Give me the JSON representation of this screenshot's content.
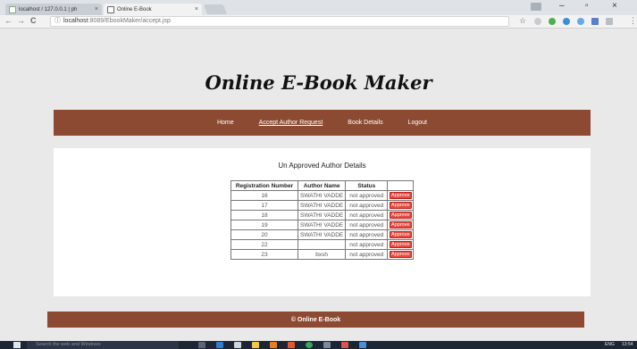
{
  "browser": {
    "tabs": [
      {
        "title": "localhost / 127.0.0.1 | ph",
        "active": false
      },
      {
        "title": "Online E-Book",
        "active": true
      }
    ],
    "window_controls": {
      "minimize": "–",
      "maximize": "▫",
      "close": "×"
    },
    "url_host": "localhost",
    "url_rest": ":8089/EbookMaker/accept.jsp",
    "nav_back": "←",
    "nav_forward": "→",
    "nav_reload": "C",
    "info_icon": "ⓘ",
    "star_icon": "☆",
    "menu_icon": "⋮"
  },
  "site": {
    "title": "Online E-Book Maker",
    "nav": [
      {
        "label": "Home",
        "current": false
      },
      {
        "label": "Accept Author Request",
        "current": true
      },
      {
        "label": "Book Details",
        "current": false
      },
      {
        "label": "Logout",
        "current": false
      }
    ]
  },
  "main": {
    "heading": "Un Approved Author Details",
    "columns": [
      "Registration Number",
      "Author Name",
      "Status",
      ""
    ],
    "approve_label": "Approve",
    "rows": [
      {
        "reg": "16",
        "name": "SWATHI VADDE",
        "status": "not approved"
      },
      {
        "reg": "17",
        "name": "SWATHI VADDE",
        "status": "not approved"
      },
      {
        "reg": "18",
        "name": "SWATHI VADDE",
        "status": "not approved"
      },
      {
        "reg": "19",
        "name": "SWATHI VADDE",
        "status": "not approved"
      },
      {
        "reg": "20",
        "name": "SWATHI VADDE",
        "status": "not approved"
      },
      {
        "reg": "22",
        "name": "",
        "status": "not approved"
      },
      {
        "reg": "23",
        "name": "bxsh",
        "status": "not approved"
      }
    ]
  },
  "footer": {
    "text": "© Online E-Book"
  },
  "taskbar": {
    "search_placeholder": "Search the web and Windows",
    "lang": "ENG",
    "time": "13:54"
  },
  "colors": {
    "brand": "#8c4a33",
    "approve_button": "#e64a3e",
    "page_background": "#e9e9e9"
  }
}
